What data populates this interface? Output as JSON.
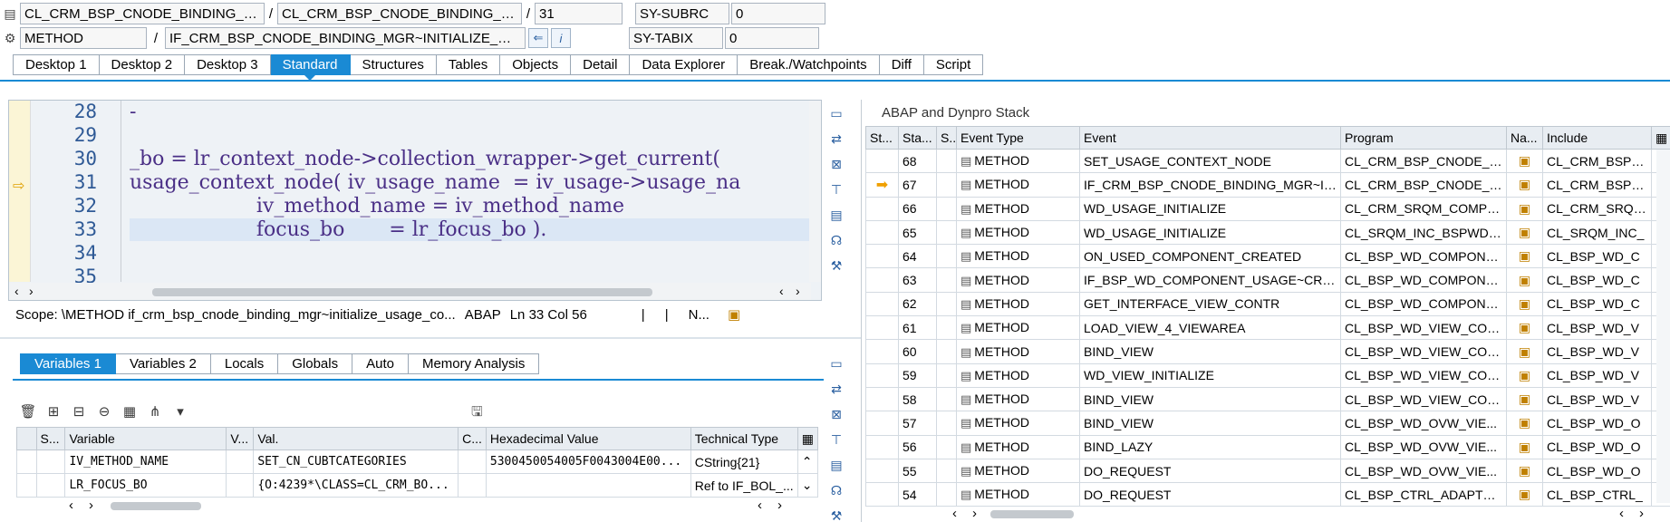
{
  "header": {
    "row1": {
      "field1": "CL_CRM_BSP_CNODE_BINDING_MGR=...",
      "sep1": "/",
      "field2": "CL_CRM_BSP_CNODE_BINDING_MGR=...",
      "sep2": "/",
      "field3": "31",
      "sysfield_label": "SY-SUBRC",
      "sysfield_value": "0"
    },
    "row2": {
      "field1": "METHOD",
      "sep1": "/",
      "field2": "IF_CRM_BSP_CNODE_BINDING_MGR~INITIALIZE_USAG...",
      "sysfield_label": "SY-TABIX",
      "sysfield_value": "0"
    }
  },
  "desktop_tabs": [
    "Desktop 1",
    "Desktop 2",
    "Desktop 3",
    "Standard",
    "Structures",
    "Tables",
    "Objects",
    "Detail",
    "Data Explorer",
    "Break./Watchpoints",
    "Diff",
    "Script"
  ],
  "code": {
    "line_numbers": [
      "28",
      "29",
      "30",
      "31",
      "32",
      "33",
      "34",
      "35"
    ],
    "lines": [
      "-",
      "",
      "_bo = lr_context_node->collection_wrapper->get_current(",
      "usage_context_node( iv_usage_name  = iv_usage->usage_na",
      "                    iv_method_name = iv_method_name",
      "                    focus_bo       = lr_focus_bo ).",
      "",
      ""
    ]
  },
  "scope_bar": {
    "scope": "Scope: \\METHOD if_crm_bsp_cnode_binding_mgr~initialize_usage_co...",
    "lang": "ABAP",
    "pos": "Ln  33 Col  56",
    "sep1": "|",
    "sep2": "|",
    "mode": "N..."
  },
  "var_tabs": [
    "Variables 1",
    "Variables 2",
    "Locals",
    "Globals",
    "Auto",
    "Memory Analysis"
  ],
  "variables": {
    "columns": [
      "S...",
      "Variable",
      "V...",
      "Val.",
      "C...",
      "Hexadecimal Value",
      "Technical Type"
    ],
    "rows": [
      [
        "",
        "",
        "IV_METHOD_NAME",
        "",
        "SET_CN_CUBTCATEGORIES",
        "",
        "5300450054005F0043004E00...",
        "CString{21}"
      ],
      [
        "",
        "",
        "LR_FOCUS_BO",
        "",
        "{O:4239*\\CLASS=CL_CRM_BO...",
        "",
        "",
        "Ref to IF_BOL_..."
      ]
    ]
  },
  "stack": {
    "title": "ABAP and Dynpro Stack",
    "columns": [
      "St...",
      "Sta...",
      "S...",
      "Event Type",
      "Event",
      "Program",
      "Na...",
      "Include"
    ],
    "rows": [
      {
        "level": "68",
        "type": "METHOD",
        "event": "SET_USAGE_CONTEXT_NODE",
        "program": "CL_CRM_BSP_CNODE_BI...",
        "include": "CL_CRM_BSP_C",
        "current": false
      },
      {
        "level": "67",
        "type": "METHOD",
        "event": "IF_CRM_BSP_CNODE_BINDING_MGR~IN...",
        "program": "CL_CRM_BSP_CNODE_BI...",
        "include": "CL_CRM_BSP_C",
        "current": true
      },
      {
        "level": "66",
        "type": "METHOD",
        "event": "WD_USAGE_INITIALIZE",
        "program": "CL_CRM_SRQM_COMP_C...",
        "include": "CL_CRM_SRQM_",
        "current": false
      },
      {
        "level": "65",
        "type": "METHOD",
        "event": "WD_USAGE_INITIALIZE",
        "program": "CL_SRQM_INC_BSPWDC...",
        "include": "CL_SRQM_INC_",
        "current": false
      },
      {
        "level": "64",
        "type": "METHOD",
        "event": "ON_USED_COMPONENT_CREATED",
        "program": "CL_BSP_WD_COMPONE...",
        "include": "CL_BSP_WD_C",
        "current": false
      },
      {
        "level": "63",
        "type": "METHOD",
        "event": "IF_BSP_WD_COMPONENT_USAGE~CRE...",
        "program": "CL_BSP_WD_COMPONE...",
        "include": "CL_BSP_WD_C",
        "current": false
      },
      {
        "level": "62",
        "type": "METHOD",
        "event": "GET_INTERFACE_VIEW_CONTR",
        "program": "CL_BSP_WD_COMPONE...",
        "include": "CL_BSP_WD_C",
        "current": false
      },
      {
        "level": "61",
        "type": "METHOD",
        "event": "LOAD_VIEW_4_VIEWAREA",
        "program": "CL_BSP_WD_VIEW_CON...",
        "include": "CL_BSP_WD_V",
        "current": false
      },
      {
        "level": "60",
        "type": "METHOD",
        "event": "BIND_VIEW",
        "program": "CL_BSP_WD_VIEW_CON...",
        "include": "CL_BSP_WD_V",
        "current": false
      },
      {
        "level": "59",
        "type": "METHOD",
        "event": "WD_VIEW_INITIALIZE",
        "program": "CL_BSP_WD_VIEW_CON...",
        "include": "CL_BSP_WD_V",
        "current": false
      },
      {
        "level": "58",
        "type": "METHOD",
        "event": "BIND_VIEW",
        "program": "CL_BSP_WD_VIEW_CON...",
        "include": "CL_BSP_WD_V",
        "current": false
      },
      {
        "level": "57",
        "type": "METHOD",
        "event": "BIND_VIEW",
        "program": "CL_BSP_WD_OVW_VIE...",
        "include": "CL_BSP_WD_O",
        "current": false
      },
      {
        "level": "56",
        "type": "METHOD",
        "event": "BIND_LAZY",
        "program": "CL_BSP_WD_OVW_VIE...",
        "include": "CL_BSP_WD_O",
        "current": false
      },
      {
        "level": "55",
        "type": "METHOD",
        "event": "DO_REQUEST",
        "program": "CL_BSP_WD_OVW_VIE...",
        "include": "CL_BSP_WD_O",
        "current": false
      },
      {
        "level": "54",
        "type": "METHOD",
        "event": "DO_REQUEST",
        "program": "CL_BSP_CTRL_ADAPTER...",
        "include": "CL_BSP_CTRL_",
        "current": false
      }
    ]
  }
}
